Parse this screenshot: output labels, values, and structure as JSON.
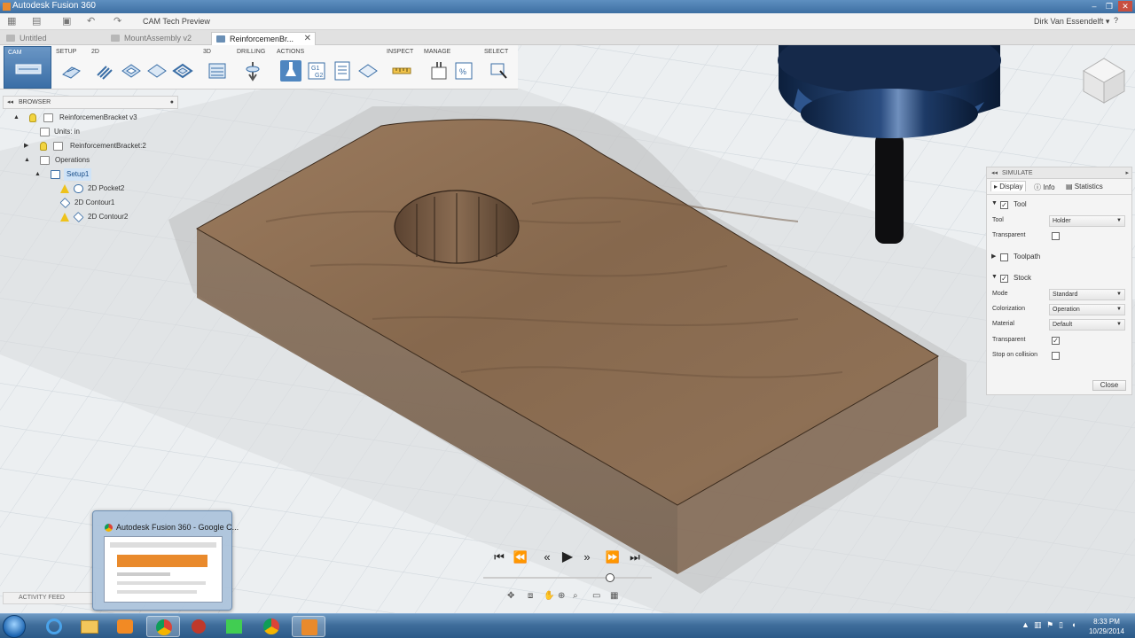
{
  "window": {
    "title": "Autodesk Fusion 360",
    "controls": [
      "–",
      "❐",
      "✕"
    ]
  },
  "quick_access": {
    "workspace_title": "CAM Tech Preview",
    "user": "Dirk Van Essendelft ▾",
    "help": "?"
  },
  "tabs": [
    {
      "label": "Untitled",
      "active": false
    },
    {
      "label": "MountAssembly v2",
      "active": false
    },
    {
      "label": "ReinforcemenBr...",
      "active": true
    }
  ],
  "toolbar": {
    "cam_label": "CAM",
    "groups": [
      "SETUP",
      "2D",
      "3D",
      "DRILLING",
      "ACTIONS",
      "INSPECT",
      "MANAGE",
      "SELECT"
    ]
  },
  "browser": {
    "header": "BROWSER",
    "items": [
      {
        "label": "ReinforcemenBracket v3"
      },
      {
        "label": "Units: in"
      },
      {
        "label": "ReinforcementBracket:2"
      },
      {
        "label": "Operations"
      },
      {
        "label": "Setup1"
      },
      {
        "label": "2D Pocket2"
      },
      {
        "label": "2D Contour1"
      },
      {
        "label": "2D Contour2"
      }
    ]
  },
  "simulate": {
    "header": "SIMULATE",
    "tabs": [
      "Display",
      "Info",
      "Statistics"
    ],
    "tool_section": "Tool",
    "tool_label": "Tool",
    "tool_value": "Holder",
    "tool_transparent_label": "Transparent",
    "toolpath_section": "Toolpath",
    "stock_section": "Stock",
    "mode_label": "Mode",
    "mode_value": "Standard",
    "colorization_label": "Colorization",
    "colorization_value": "Operation",
    "material_label": "Material",
    "material_value": "Default",
    "stock_transparent_label": "Transparent",
    "stop_label": "Stop on collision",
    "close_label": "Close",
    "tool_checked": true,
    "toolpath_checked": false,
    "stock_checked": true,
    "tool_transparent_checked": false,
    "stock_transparent_checked": true,
    "stop_checked": false
  },
  "playback": {
    "position": 0.75
  },
  "activity_feed": "ACTIVITY FEED",
  "preview": {
    "title": "Autodesk Fusion 360 - Google C..."
  },
  "clock": {
    "time": "8:33 PM",
    "date": "10/29/2014"
  },
  "colors": {
    "wood": "#8a6a4d",
    "accent": "#3a6ea6"
  }
}
